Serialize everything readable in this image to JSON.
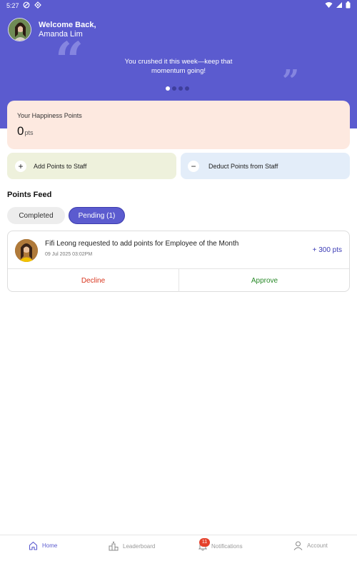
{
  "status_bar": {
    "time": "5:27"
  },
  "header": {
    "welcome_line1": "Welcome Back,",
    "welcome_line2": "Amanda Lim",
    "quote_open": "“",
    "quote_close": "”",
    "motivation": "You crushed it this week—keep that momentum going!",
    "carousel_total": 4,
    "carousel_active": 1,
    "background_color": "#5B5BCF"
  },
  "points_card": {
    "label": "Your Happiness Points",
    "value": "0",
    "unit": "pts"
  },
  "actions": {
    "add_label": "Add Points to Staff",
    "add_icon": "+",
    "deduct_label": "Deduct Points from Staff",
    "deduct_icon": "−"
  },
  "feed": {
    "title": "Points Feed",
    "tabs": [
      {
        "label": "Completed",
        "active": false
      },
      {
        "label": "Pending (1)",
        "active": true
      }
    ],
    "requests": [
      {
        "text": "Fifi Leong requested to add points for Employee of the Month",
        "date": "09 Jul 2025 03:02PM",
        "points": "+ 300 pts",
        "decline_label": "Decline",
        "approve_label": "Approve"
      }
    ]
  },
  "bottom_nav": {
    "items": [
      {
        "label": "Home",
        "icon": "home-icon",
        "active": true
      },
      {
        "label": "Leaderboard",
        "icon": "leaderboard-icon",
        "active": false
      },
      {
        "label": "Notifications",
        "icon": "bell-icon",
        "active": false,
        "badge": "11"
      },
      {
        "label": "Account",
        "icon": "user-icon",
        "active": false
      }
    ]
  },
  "colors": {
    "accent": "#5B5BCF",
    "decline": "#d9361f",
    "approve": "#2a8a2a"
  }
}
